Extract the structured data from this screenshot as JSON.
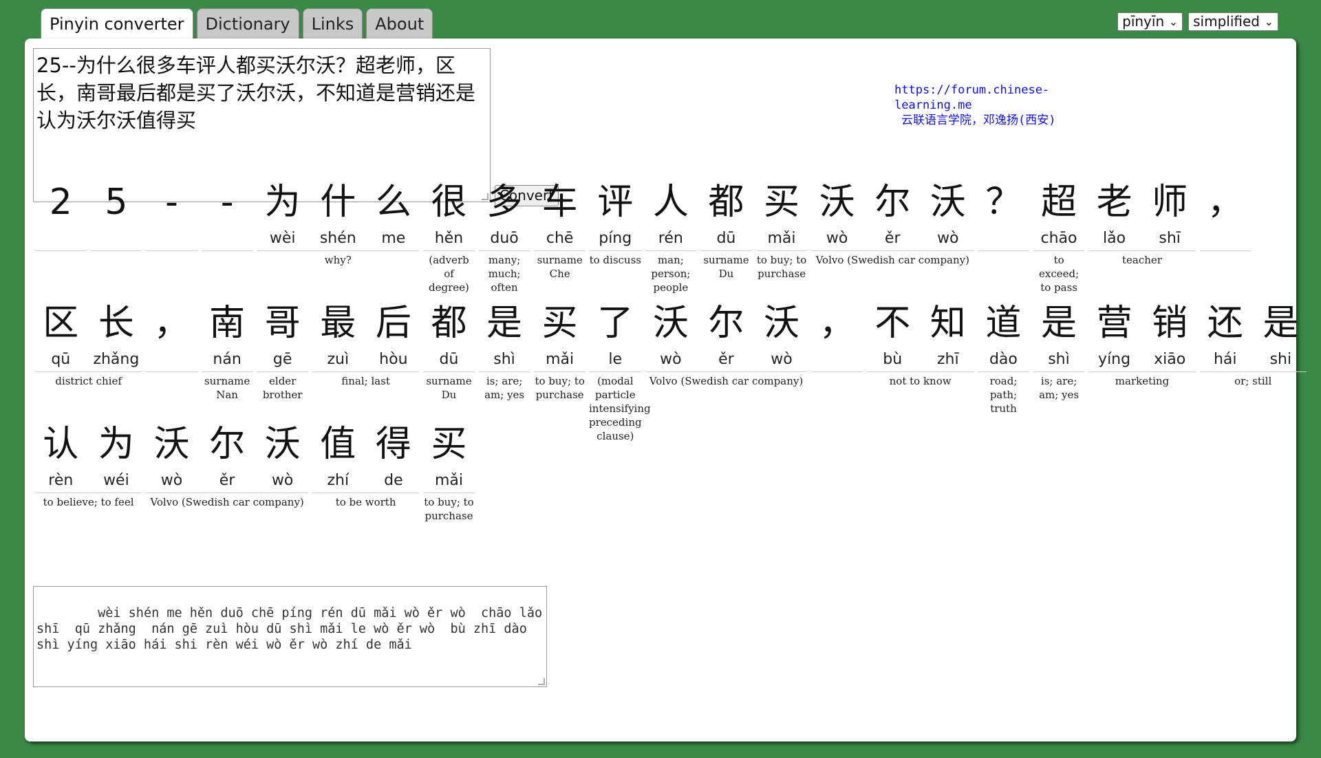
{
  "tabs": [
    {
      "label": "Pinyin converter",
      "active": true
    },
    {
      "label": "Dictionary",
      "active": false
    },
    {
      "label": "Links",
      "active": false
    },
    {
      "label": "About",
      "active": false
    }
  ],
  "selects": {
    "romanization": "pīnyīn",
    "script": "simplified"
  },
  "input": {
    "text": "25--为什么很多车评人都买沃尔沃？超老师，区长，南哥最后都是买了沃尔沃，不知道是营销还是认为沃尔沃值得买"
  },
  "convert_label": "Convert",
  "credit": {
    "url": "https://forum.chinese-learning.me",
    "author": "云联语言学院，邓逸扬(西安)"
  },
  "rows": [
    {
      "chars": [
        {
          "han": "2",
          "py": ""
        },
        {
          "han": "5",
          "py": ""
        },
        {
          "han": "-",
          "py": ""
        },
        {
          "han": "-",
          "py": ""
        },
        {
          "han": "为",
          "py": "wèi"
        },
        {
          "han": "什",
          "py": "shén"
        },
        {
          "han": "么",
          "py": "me"
        },
        {
          "han": "很",
          "py": "hěn"
        },
        {
          "han": "多",
          "py": "duō"
        },
        {
          "han": "车",
          "py": "chē"
        },
        {
          "han": "评",
          "py": "píng"
        },
        {
          "han": "人",
          "py": "rén"
        },
        {
          "han": "都",
          "py": "dū"
        },
        {
          "han": "买",
          "py": "mǎi"
        },
        {
          "han": "沃",
          "py": "wò"
        },
        {
          "han": "尔",
          "py": "ěr"
        },
        {
          "han": "沃",
          "py": "wò"
        },
        {
          "han": "？",
          "py": ""
        },
        {
          "han": "超",
          "py": "chāo"
        },
        {
          "han": "老",
          "py": "lǎo"
        },
        {
          "han": "师",
          "py": "shī"
        },
        {
          "han": "，",
          "py": ""
        }
      ],
      "groups": [
        {
          "start": 0,
          "span": 1,
          "gloss": ""
        },
        {
          "start": 1,
          "span": 1,
          "gloss": ""
        },
        {
          "start": 2,
          "span": 1,
          "gloss": ""
        },
        {
          "start": 3,
          "span": 1,
          "gloss": ""
        },
        {
          "start": 4,
          "span": 3,
          "gloss": "why?"
        },
        {
          "start": 7,
          "span": 1,
          "gloss": "(adverb of degree)"
        },
        {
          "start": 8,
          "span": 1,
          "gloss": "many; much; often"
        },
        {
          "start": 9,
          "span": 1,
          "gloss": "surname Che"
        },
        {
          "start": 10,
          "span": 1,
          "gloss": "to discuss"
        },
        {
          "start": 11,
          "span": 1,
          "gloss": "man; person; people"
        },
        {
          "start": 12,
          "span": 1,
          "gloss": "surname Du"
        },
        {
          "start": 13,
          "span": 1,
          "gloss": "to buy; to purchase"
        },
        {
          "start": 14,
          "span": 3,
          "gloss": "Volvo (Swedish car company)"
        },
        {
          "start": 17,
          "span": 1,
          "gloss": ""
        },
        {
          "start": 18,
          "span": 1,
          "gloss": "to exceed; to pass"
        },
        {
          "start": 19,
          "span": 2,
          "gloss": "teacher"
        },
        {
          "start": 21,
          "span": 1,
          "gloss": ""
        }
      ]
    },
    {
      "chars": [
        {
          "han": "区",
          "py": "qū"
        },
        {
          "han": "长",
          "py": "zhǎng"
        },
        {
          "han": "，",
          "py": ""
        },
        {
          "han": "南",
          "py": "nán"
        },
        {
          "han": "哥",
          "py": "gē"
        },
        {
          "han": "最",
          "py": "zuì"
        },
        {
          "han": "后",
          "py": "hòu"
        },
        {
          "han": "都",
          "py": "dū"
        },
        {
          "han": "是",
          "py": "shì"
        },
        {
          "han": "买",
          "py": "mǎi"
        },
        {
          "han": "了",
          "py": "le"
        },
        {
          "han": "沃",
          "py": "wò"
        },
        {
          "han": "尔",
          "py": "ěr"
        },
        {
          "han": "沃",
          "py": "wò"
        },
        {
          "han": "，",
          "py": ""
        },
        {
          "han": "不",
          "py": "bù"
        },
        {
          "han": "知",
          "py": "zhī"
        },
        {
          "han": "道",
          "py": "dào"
        },
        {
          "han": "是",
          "py": "shì"
        },
        {
          "han": "营",
          "py": "yíng"
        },
        {
          "han": "销",
          "py": "xiāo"
        },
        {
          "han": "还",
          "py": "hái"
        },
        {
          "han": "是",
          "py": "shi"
        }
      ],
      "groups": [
        {
          "start": 0,
          "span": 2,
          "gloss": "district chief"
        },
        {
          "start": 2,
          "span": 1,
          "gloss": ""
        },
        {
          "start": 3,
          "span": 1,
          "gloss": "surname Nan"
        },
        {
          "start": 4,
          "span": 1,
          "gloss": "elder brother"
        },
        {
          "start": 5,
          "span": 2,
          "gloss": "final; last"
        },
        {
          "start": 7,
          "span": 1,
          "gloss": "surname Du"
        },
        {
          "start": 8,
          "span": 1,
          "gloss": "is; are; am; yes"
        },
        {
          "start": 9,
          "span": 1,
          "gloss": "to buy; to purchase"
        },
        {
          "start": 10,
          "span": 1,
          "gloss": "(modal particle intensifying preceding clause)"
        },
        {
          "start": 11,
          "span": 3,
          "gloss": "Volvo (Swedish car company)"
        },
        {
          "start": 14,
          "span": 1,
          "gloss": ""
        },
        {
          "start": 15,
          "span": 2,
          "gloss": "not to know"
        },
        {
          "start": 17,
          "span": 1,
          "gloss": "road; path; truth"
        },
        {
          "start": 18,
          "span": 1,
          "gloss": "is; are; am; yes"
        },
        {
          "start": 19,
          "span": 2,
          "gloss": "marketing"
        },
        {
          "start": 21,
          "span": 2,
          "gloss": "or; still"
        }
      ]
    },
    {
      "chars": [
        {
          "han": "认",
          "py": "rèn"
        },
        {
          "han": "为",
          "py": "wéi"
        },
        {
          "han": "沃",
          "py": "wò"
        },
        {
          "han": "尔",
          "py": "ěr"
        },
        {
          "han": "沃",
          "py": "wò"
        },
        {
          "han": "值",
          "py": "zhí"
        },
        {
          "han": "得",
          "py": "de"
        },
        {
          "han": "买",
          "py": "mǎi"
        }
      ],
      "groups": [
        {
          "start": 0,
          "span": 2,
          "gloss": "to believe; to feel"
        },
        {
          "start": 2,
          "span": 3,
          "gloss": "Volvo (Swedish car company)"
        },
        {
          "start": 5,
          "span": 2,
          "gloss": "to be worth"
        },
        {
          "start": 7,
          "span": 1,
          "gloss": "to buy; to purchase"
        }
      ]
    }
  ],
  "output": {
    "text": "    wèi shén me hěn duō chē píng rén dū mǎi wò ěr wò  chāo lǎo shī  qū zhǎng  nán gē zuì hòu dū shì mǎi le wò ěr wò  bù zhī dào shì yíng xiāo hái shi rèn wéi wò ěr wò zhí de mǎi"
  }
}
